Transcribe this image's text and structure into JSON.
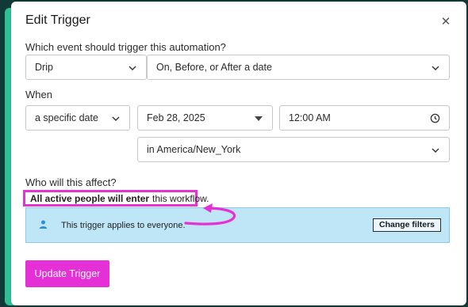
{
  "modal": {
    "title": "Edit Trigger",
    "close_icon": "close-icon"
  },
  "event_section": {
    "label": "Which event should trigger this automation?",
    "event_type": {
      "value": "Drip"
    },
    "timing": {
      "value": "On, Before, or After a date"
    }
  },
  "when_section": {
    "label": "When",
    "date_mode": {
      "value": "a specific date"
    },
    "date": {
      "value": "Feb 28, 2025"
    },
    "time": {
      "value": "12:00 AM"
    },
    "timezone": {
      "value": "in America/New_York"
    }
  },
  "affect_section": {
    "label": "Who will this affect?",
    "warning": {
      "icon": "warning-icon",
      "bold_text": "All active people will enter",
      "text": "this workflow."
    },
    "info_banner": {
      "icon": "person-icon",
      "text": "This trigger applies to everyone.",
      "button_label": "Change filters"
    }
  },
  "footer": {
    "update_button_label": "Update Trigger"
  },
  "colors": {
    "accent_magenta": "#e630d7",
    "banner_blue": "#bfe6f7",
    "backdrop_green": "#2fbf95"
  }
}
